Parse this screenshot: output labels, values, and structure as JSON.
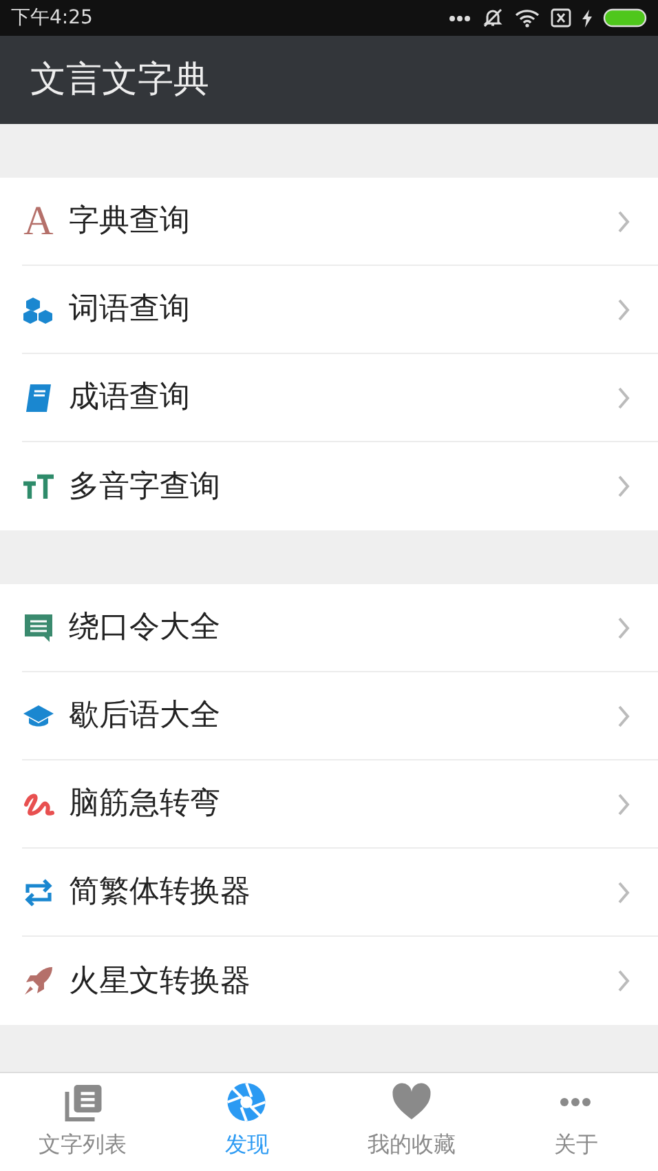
{
  "status_bar": {
    "time": "下午4:25"
  },
  "app_bar": {
    "title": "文言文字典"
  },
  "sections": [
    {
      "items": [
        {
          "label": "字典查询",
          "kind": "letter",
          "glyph": "A"
        },
        {
          "label": "词语查询",
          "kind": "cubes"
        },
        {
          "label": "成语查询",
          "kind": "book"
        },
        {
          "label": "多音字查询",
          "kind": "textsize"
        }
      ]
    },
    {
      "items": [
        {
          "label": "绕口令大全",
          "kind": "chat"
        },
        {
          "label": "歇后语大全",
          "kind": "cap"
        },
        {
          "label": "脑筋急转弯",
          "kind": "squiggle"
        },
        {
          "label": "简繁体转换器",
          "kind": "swap"
        },
        {
          "label": "火星文转换器",
          "kind": "rocket"
        }
      ]
    }
  ],
  "bottom_nav": [
    {
      "label": "文字列表",
      "kind": "list",
      "selected": false
    },
    {
      "label": "发现",
      "kind": "aperture",
      "selected": true
    },
    {
      "label": "我的收藏",
      "kind": "heart",
      "selected": false
    },
    {
      "label": "关于",
      "kind": "dots",
      "selected": false
    }
  ]
}
